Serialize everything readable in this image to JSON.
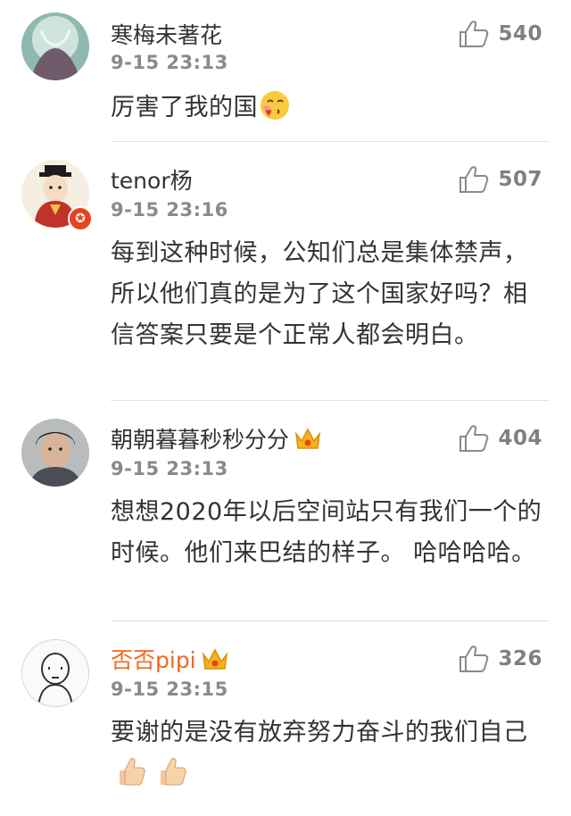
{
  "comments": [
    {
      "username": "寒梅未著花",
      "time": "9-15 23:13",
      "likes": "540",
      "text": "厉害了我的国",
      "emojis": [
        "blushing-kiss-emoji"
      ],
      "username_color": "#333333",
      "verified": false,
      "crown": false
    },
    {
      "username": "tenor杨",
      "time": "9-15 23:16",
      "likes": "507",
      "text": "每到这种时候，公知们总是集体禁声，所以他们真的是为了这个国家好吗？相信答案只要是个正常人都会明白。",
      "username_color": "#333333",
      "verified": true,
      "crown": false
    },
    {
      "username": "朝朝暮暮秒秒分分",
      "time": "9-15 23:13",
      "likes": "404",
      "text": "想想2020年以后空间站只有我们一个的时候。他们来巴结的样子。 哈哈哈哈。",
      "username_color": "#333333",
      "verified": false,
      "crown": true
    },
    {
      "username": "否否pipi",
      "time": "9-15 23:15",
      "likes": "326",
      "text": "要谢的是没有放弃努力奋斗的我们自己",
      "emojis": [
        "thumbs-up-emoji",
        "thumbs-up-emoji"
      ],
      "username_color": "#f0681f",
      "verified": false,
      "crown": true
    }
  ],
  "colors": {
    "accent": "#f0681f",
    "verified_badge": "#e8431e",
    "crown": "#f6b31b",
    "text": "#333333",
    "meta": "#8a8a8a",
    "divider": "#e3e3e3"
  }
}
